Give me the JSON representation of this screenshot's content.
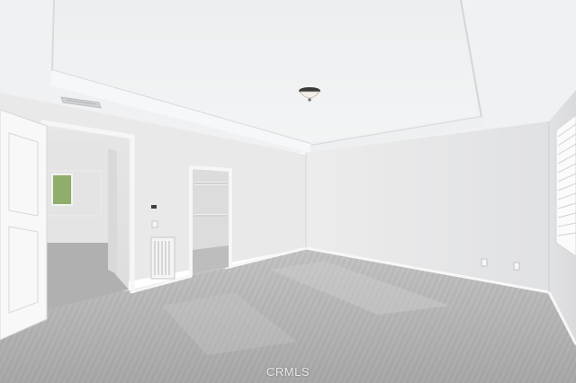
{
  "watermark": "CRMLS",
  "colors": {
    "ceiling": "#eef0f1",
    "walls": "#e3e4e6",
    "carpet": "#b9b9b9",
    "trim": "#f4f5f6",
    "door": "#f7f7f8"
  }
}
